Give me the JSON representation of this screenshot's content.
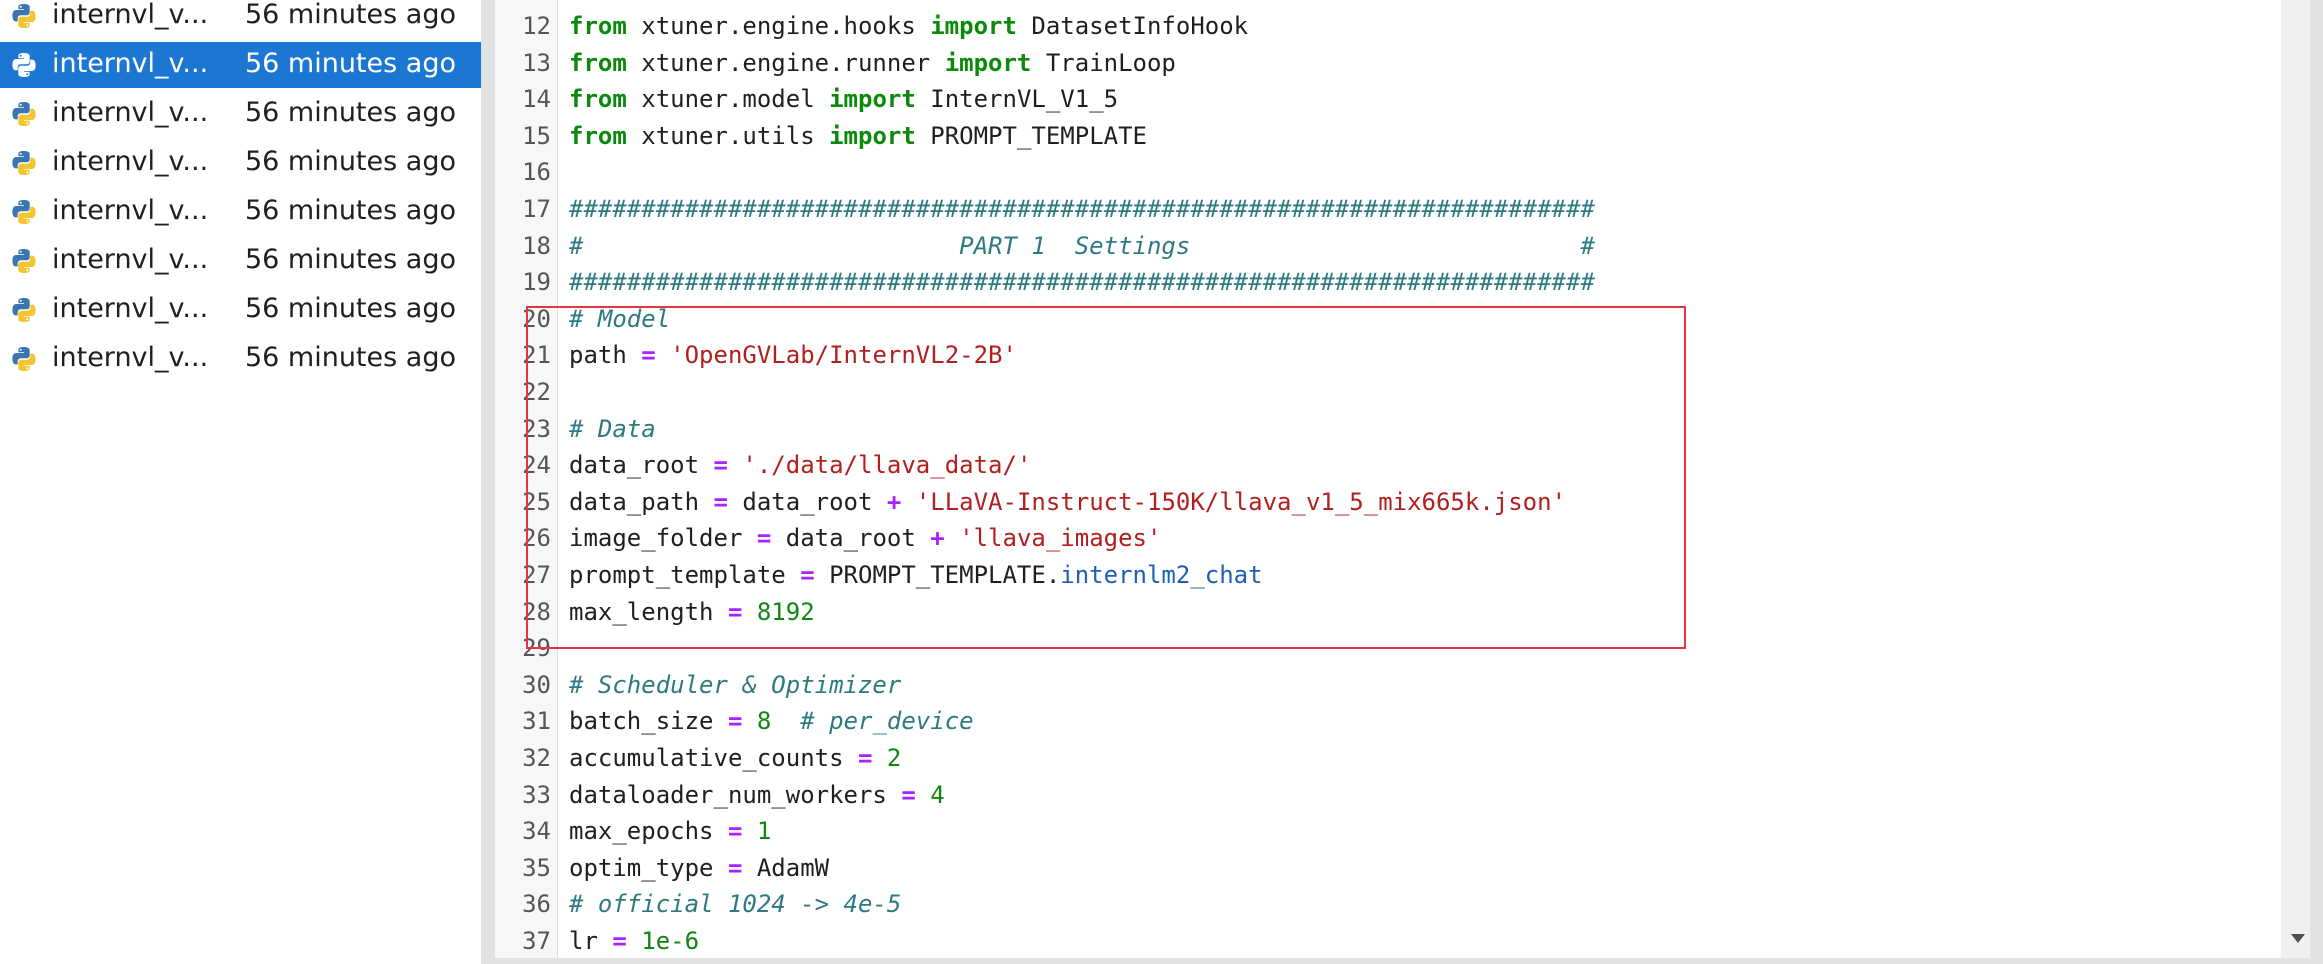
{
  "file_list": {
    "items": [
      {
        "name": "internvl_v...",
        "time": "56 minutes ago",
        "selected": false,
        "icon": "python-file-icon"
      },
      {
        "name": "internvl_v...",
        "time": "56 minutes ago",
        "selected": true,
        "icon": "python-file-icon"
      },
      {
        "name": "internvl_v...",
        "time": "56 minutes ago",
        "selected": false,
        "icon": "python-file-icon"
      },
      {
        "name": "internvl_v...",
        "time": "56 minutes ago",
        "selected": false,
        "icon": "python-file-icon"
      },
      {
        "name": "internvl_v...",
        "time": "56 minutes ago",
        "selected": false,
        "icon": "python-file-icon"
      },
      {
        "name": "internvl_v...",
        "time": "56 minutes ago",
        "selected": false,
        "icon": "python-file-icon"
      },
      {
        "name": "internvl_v...",
        "time": "56 minutes ago",
        "selected": false,
        "icon": "python-file-icon"
      },
      {
        "name": "internvl_v...",
        "time": "56 minutes ago",
        "selected": false,
        "icon": "python-file-icon"
      }
    ]
  },
  "editor": {
    "lines": [
      {
        "no": "12",
        "tokens": [
          [
            "kw",
            "from"
          ],
          [
            "nm",
            " xtuner.engine.hooks "
          ],
          [
            "kw",
            "import"
          ],
          [
            "nm",
            " DatasetInfoHook"
          ]
        ]
      },
      {
        "no": "13",
        "tokens": [
          [
            "kw",
            "from"
          ],
          [
            "nm",
            " xtuner.engine.runner "
          ],
          [
            "kw",
            "import"
          ],
          [
            "nm",
            " TrainLoop"
          ]
        ]
      },
      {
        "no": "14",
        "tokens": [
          [
            "kw",
            "from"
          ],
          [
            "nm",
            " xtuner.model "
          ],
          [
            "kw",
            "import"
          ],
          [
            "nm",
            " InternVL_V1_5"
          ]
        ]
      },
      {
        "no": "15",
        "tokens": [
          [
            "kw",
            "from"
          ],
          [
            "nm",
            " xtuner.utils "
          ],
          [
            "kw",
            "import"
          ],
          [
            "nm",
            " PROMPT_TEMPLATE"
          ]
        ]
      },
      {
        "no": "16",
        "tokens": []
      },
      {
        "no": "17",
        "tokens": [
          [
            "cm",
            "#######################################################################"
          ]
        ]
      },
      {
        "no": "18",
        "tokens": [
          [
            "cm",
            "#                          PART 1  Settings                           #"
          ]
        ]
      },
      {
        "no": "19",
        "tokens": [
          [
            "cm",
            "#######################################################################"
          ]
        ]
      },
      {
        "no": "20",
        "tokens": [
          [
            "cm",
            "# Model"
          ]
        ]
      },
      {
        "no": "21",
        "tokens": [
          [
            "nm",
            "path "
          ],
          [
            "op",
            "="
          ],
          [
            "nm",
            " "
          ],
          [
            "str",
            "'OpenGVLab/InternVL2-2B'"
          ]
        ]
      },
      {
        "no": "22",
        "tokens": []
      },
      {
        "no": "23",
        "tokens": [
          [
            "cm",
            "# Data"
          ]
        ]
      },
      {
        "no": "24",
        "tokens": [
          [
            "nm",
            "data_root "
          ],
          [
            "op",
            "="
          ],
          [
            "nm",
            " "
          ],
          [
            "str",
            "'./data/llava_data/'"
          ]
        ]
      },
      {
        "no": "25",
        "tokens": [
          [
            "nm",
            "data_path "
          ],
          [
            "op",
            "="
          ],
          [
            "nm",
            " data_root "
          ],
          [
            "op",
            "+"
          ],
          [
            "nm",
            " "
          ],
          [
            "str",
            "'LLaVA-Instruct-150K/llava_v1_5_mix665k.json'"
          ]
        ]
      },
      {
        "no": "26",
        "tokens": [
          [
            "nm",
            "image_folder "
          ],
          [
            "op",
            "="
          ],
          [
            "nm",
            " data_root "
          ],
          [
            "op",
            "+"
          ],
          [
            "nm",
            " "
          ],
          [
            "str",
            "'llava_images'"
          ]
        ]
      },
      {
        "no": "27",
        "tokens": [
          [
            "nm",
            "prompt_template "
          ],
          [
            "op",
            "="
          ],
          [
            "nm",
            " PROMPT_TEMPLATE."
          ],
          [
            "attr",
            "internlm2_chat"
          ]
        ]
      },
      {
        "no": "28",
        "tokens": [
          [
            "nm",
            "max_length "
          ],
          [
            "op",
            "="
          ],
          [
            "nm",
            " "
          ],
          [
            "num",
            "8192"
          ]
        ]
      },
      {
        "no": "29",
        "tokens": []
      },
      {
        "no": "30",
        "tokens": [
          [
            "cm",
            "# Scheduler & Optimizer"
          ]
        ]
      },
      {
        "no": "31",
        "tokens": [
          [
            "nm",
            "batch_size "
          ],
          [
            "op",
            "="
          ],
          [
            "nm",
            " "
          ],
          [
            "num",
            "8"
          ],
          [
            "nm",
            "  "
          ],
          [
            "cm",
            "# per_device"
          ]
        ]
      },
      {
        "no": "32",
        "tokens": [
          [
            "nm",
            "accumulative_counts "
          ],
          [
            "op",
            "="
          ],
          [
            "nm",
            " "
          ],
          [
            "num",
            "2"
          ]
        ]
      },
      {
        "no": "33",
        "tokens": [
          [
            "nm",
            "dataloader_num_workers "
          ],
          [
            "op",
            "="
          ],
          [
            "nm",
            " "
          ],
          [
            "num",
            "4"
          ]
        ]
      },
      {
        "no": "34",
        "tokens": [
          [
            "nm",
            "max_epochs "
          ],
          [
            "op",
            "="
          ],
          [
            "nm",
            " "
          ],
          [
            "num",
            "1"
          ]
        ]
      },
      {
        "no": "35",
        "tokens": [
          [
            "nm",
            "optim_type "
          ],
          [
            "op",
            "="
          ],
          [
            "nm",
            " AdamW"
          ]
        ]
      },
      {
        "no": "36",
        "tokens": [
          [
            "cm",
            "# official 1024 -> 4e-5"
          ]
        ]
      },
      {
        "no": "37",
        "tokens": [
          [
            "nm",
            "lr "
          ],
          [
            "op",
            "="
          ],
          [
            "nm",
            " "
          ],
          [
            "num",
            "1e-6"
          ]
        ]
      }
    ]
  },
  "colors": {
    "selection": "#1c77d2",
    "keyword": "#0a8a0a",
    "comment": "#2e7a82",
    "string": "#b31e1e",
    "number": "#128512",
    "operator": "#aa22ff",
    "attribute": "#1c5fb5",
    "highlight_box": "#e5353f"
  }
}
